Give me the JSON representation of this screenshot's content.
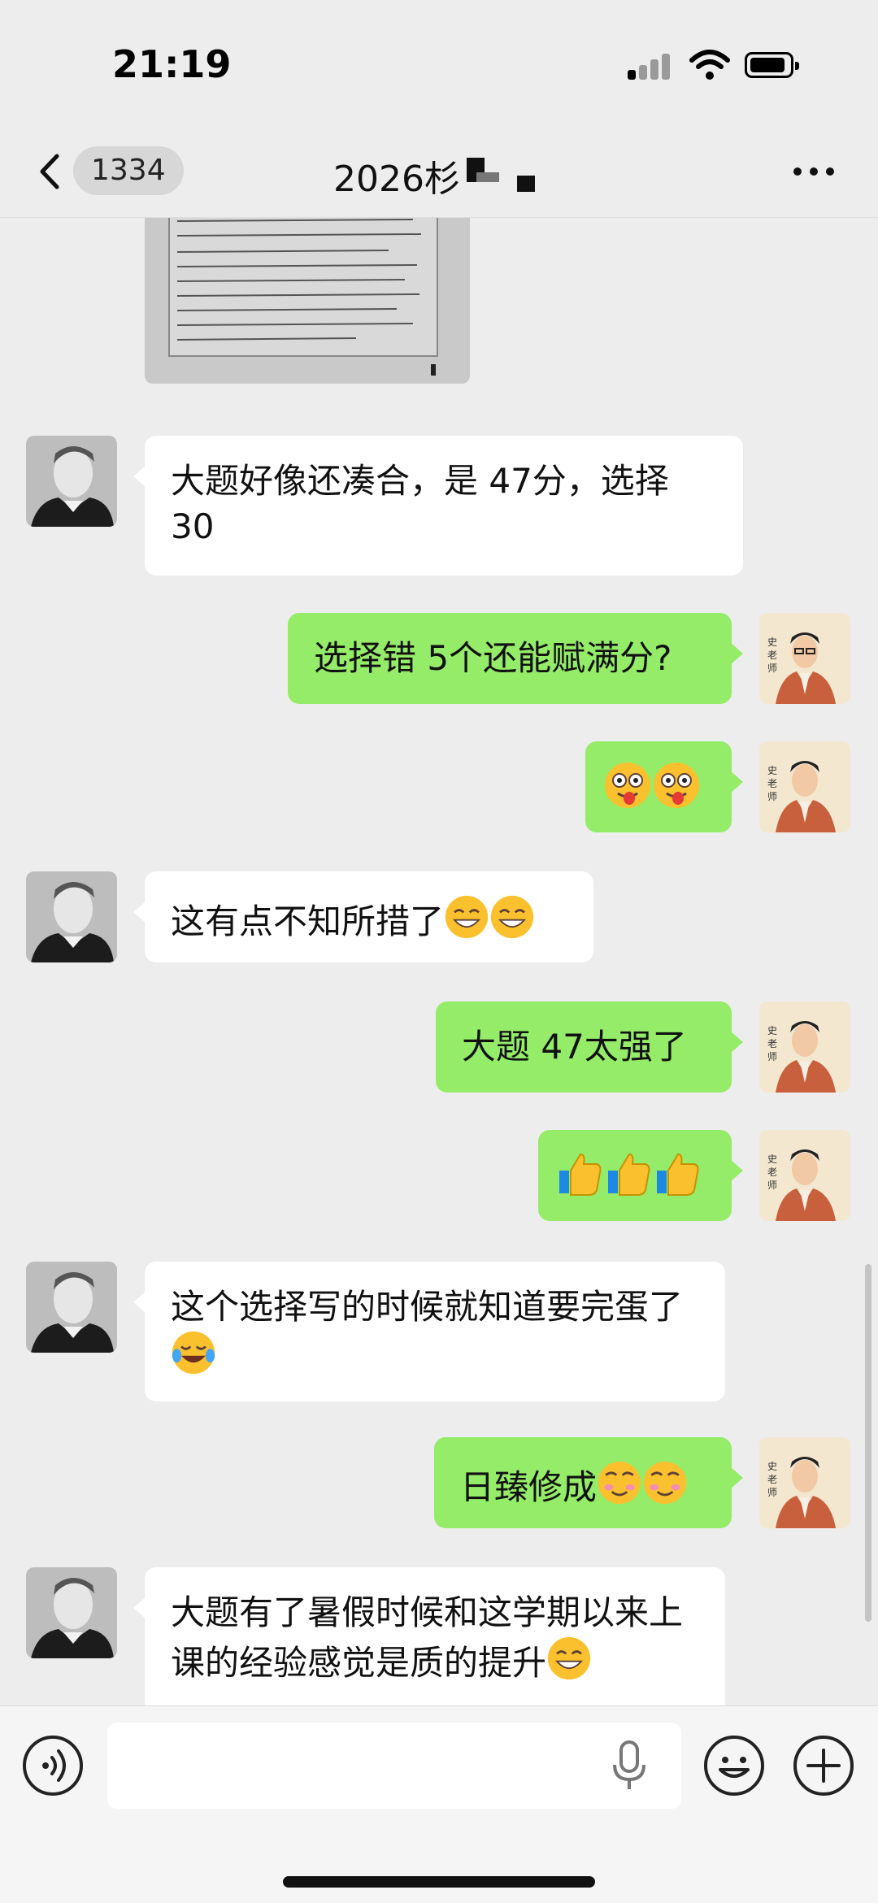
{
  "status_bar": {
    "time": "21:19"
  },
  "nav": {
    "back_label": "",
    "unread_count": "1334",
    "title": "2026",
    "title_suffix": "杉"
  },
  "messages": [
    {
      "side": "in",
      "type": "image"
    },
    {
      "side": "in",
      "text": "大题好像还凑合，是 47分，选择 30"
    },
    {
      "side": "out",
      "text": "选择错 5个还能赋满分?"
    },
    {
      "side": "out",
      "text": "",
      "emoji": [
        "tongue-face-emoji",
        "tongue-face-emoji"
      ]
    },
    {
      "side": "in",
      "text": "这有点不知所措了",
      "emoji": [
        "grin-emoji",
        "grin-emoji"
      ]
    },
    {
      "side": "out",
      "text": "大题 47太强了"
    },
    {
      "side": "out",
      "text": "",
      "emoji": [
        "thumbs-up-emoji",
        "thumbs-up-emoji",
        "thumbs-up-emoji"
      ]
    },
    {
      "side": "in",
      "text": "这个选择写的时候就知道要完蛋了",
      "emoji": [
        "tears-of-joy-emoji"
      ]
    },
    {
      "side": "out",
      "text": "日臻修成",
      "emoji": [
        "blush-emoji",
        "blush-emoji"
      ]
    },
    {
      "side": "in",
      "text": "大题有了暑假时候和这学期以来上课的经验感觉是质的提升",
      "emoji": [
        "grin-emoji"
      ]
    }
  ],
  "colors": {
    "outgoing_bubble": "#95ec69",
    "incoming_bubble": "#ffffff",
    "background": "#ededed"
  }
}
